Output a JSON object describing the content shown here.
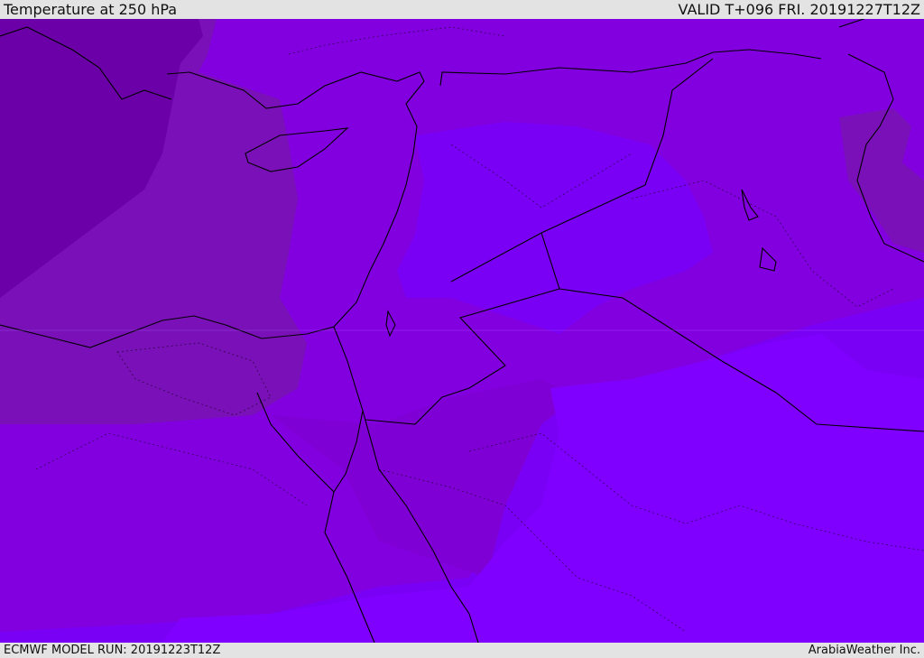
{
  "header": {
    "title": "Temperature at 250 hPa",
    "valid": "VALID T+096 FRI. 20191227T12Z"
  },
  "footer": {
    "model_run": "ECMWF MODEL RUN: 20191223T12Z",
    "credit": "ArabiaWeather Inc."
  },
  "map": {
    "variable": "temperature",
    "level": "250 hPa",
    "colors": {
      "coldest": "#6b00a8",
      "cold": "#7a10b8",
      "mid": "#7f00d5",
      "mid2": "#8200e0",
      "warm": "#7a00f5",
      "warmest": "#7f00ff",
      "borders": "#000000"
    }
  }
}
